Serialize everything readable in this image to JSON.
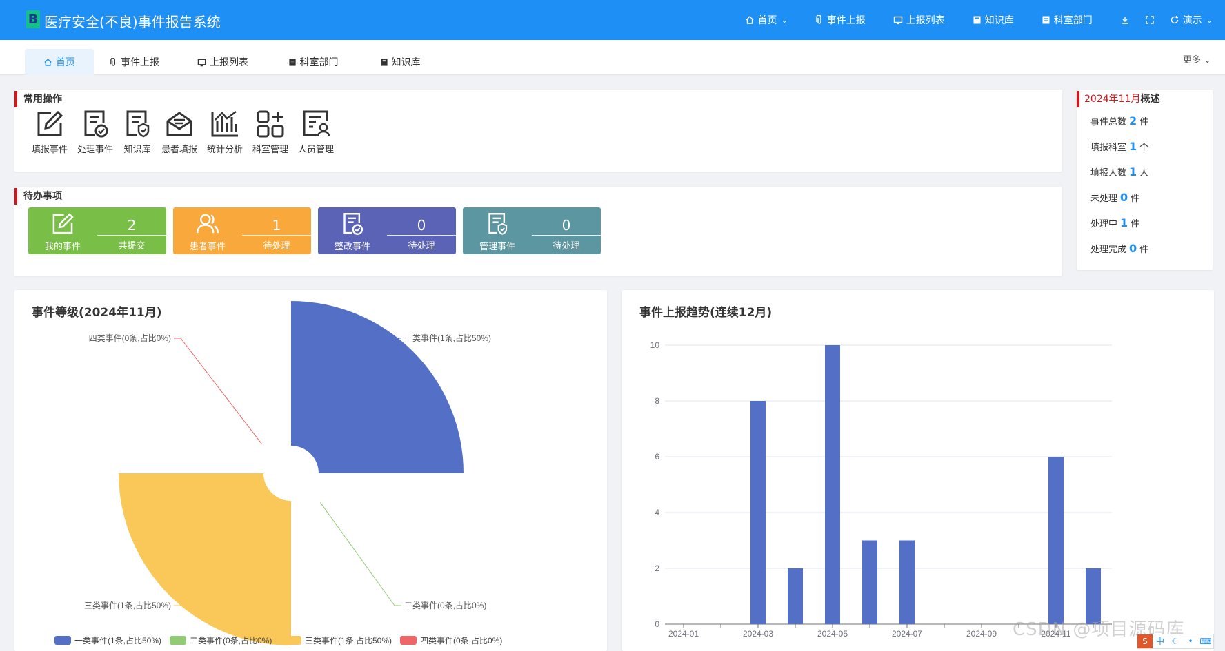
{
  "header": {
    "logo_letter": "B",
    "app_title": "医疗安全(不良)事件报告系统",
    "nav": [
      {
        "label": "首页",
        "icon": "home-icon"
      },
      {
        "label": "事件上报",
        "icon": "paperclip-icon"
      },
      {
        "label": "上报列表",
        "icon": "monitor-icon"
      },
      {
        "label": "知识库",
        "icon": "book-icon"
      },
      {
        "label": "科室部门",
        "icon": "document-icon"
      }
    ],
    "user_label": "演示",
    "tool_icons": [
      "download-icon",
      "fullscreen-icon",
      "refresh-icon"
    ]
  },
  "tabs": {
    "items": [
      {
        "label": "首页",
        "icon": "home-icon",
        "active": true
      },
      {
        "label": "事件上报",
        "icon": "paperclip-icon"
      },
      {
        "label": "上报列表",
        "icon": "monitor-icon"
      },
      {
        "label": "科室部门",
        "icon": "document-icon"
      },
      {
        "label": "知识库",
        "icon": "book-icon"
      }
    ],
    "more_label": "更多"
  },
  "quick_ops": {
    "title": "常用操作",
    "items": [
      {
        "label": "填报事件",
        "icon": "edit-icon"
      },
      {
        "label": "处理事件",
        "icon": "process-doc-icon"
      },
      {
        "label": "知识库",
        "icon": "shield-doc-icon"
      },
      {
        "label": "患者填报",
        "icon": "mail-open-icon"
      },
      {
        "label": "统计分析",
        "icon": "bar-chart-icon"
      },
      {
        "label": "科室管理",
        "icon": "grid-plus-icon"
      },
      {
        "label": "人员管理",
        "icon": "person-doc-icon"
      }
    ]
  },
  "todo": {
    "title": "待办事项",
    "cards": [
      {
        "name": "我的事件",
        "count": "2",
        "label": "共提交",
        "color": "#79bf47",
        "icon": "edit-icon"
      },
      {
        "name": "患者事件",
        "count": "1",
        "label": "待处理",
        "color": "#f9a93b",
        "icon": "people-icon"
      },
      {
        "name": "整改事件",
        "count": "0",
        "label": "待处理",
        "color": "#5b63b7",
        "icon": "process-doc-icon"
      },
      {
        "name": "管理事件",
        "count": "0",
        "label": "待处理",
        "color": "#5b96a1",
        "icon": "shield-doc-icon"
      }
    ]
  },
  "summary": {
    "month": "2024年11月",
    "suffix": "概述",
    "rows": [
      {
        "label": "事件总数",
        "value": "2",
        "unit": "件"
      },
      {
        "label": "填报科室",
        "value": "1",
        "unit": "个"
      },
      {
        "label": "填报人数",
        "value": "1",
        "unit": "人"
      },
      {
        "label": "未处理",
        "value": "0",
        "unit": "件"
      },
      {
        "label": "处理中",
        "value": "1",
        "unit": "件"
      },
      {
        "label": "处理完成",
        "value": "0",
        "unit": "件"
      }
    ]
  },
  "watermark": "CSDN @项目源码库",
  "chart_data": [
    {
      "type": "pie",
      "title": "事件等级(2024年11月)",
      "subtype": "rose",
      "series": [
        {
          "name": "一类事件(1条,占比50%)",
          "value": 1,
          "color": "#5470c6"
        },
        {
          "name": "二类事件(0条,占比0%)",
          "value": 0,
          "color": "#91cc75"
        },
        {
          "name": "三类事件(1条,占比50%)",
          "value": 1,
          "color": "#fac858"
        },
        {
          "name": "四类事件(0条,占比0%)",
          "value": 0,
          "color": "#ee6666"
        }
      ],
      "legend": "bottom"
    },
    {
      "type": "bar",
      "title": "事件上报趋势(连续12月)",
      "categories": [
        "2024-01",
        "2024-02",
        "2024-03",
        "2024-04",
        "2024-05",
        "2024-06",
        "2024-07",
        "2024-08",
        "2024-09",
        "2024-10",
        "2024-11",
        "2024-12"
      ],
      "x_tick_labels": [
        "2024-01",
        "2024-03",
        "2024-05",
        "2024-07",
        "2024-09",
        "2024-11"
      ],
      "values": [
        0,
        0,
        8,
        2,
        10,
        3,
        3,
        0,
        0,
        0,
        6,
        2
      ],
      "ylim": [
        0,
        10
      ],
      "yticks": [
        0,
        2,
        4,
        6,
        8,
        10
      ],
      "color": "#5470c6",
      "grid": true
    }
  ]
}
